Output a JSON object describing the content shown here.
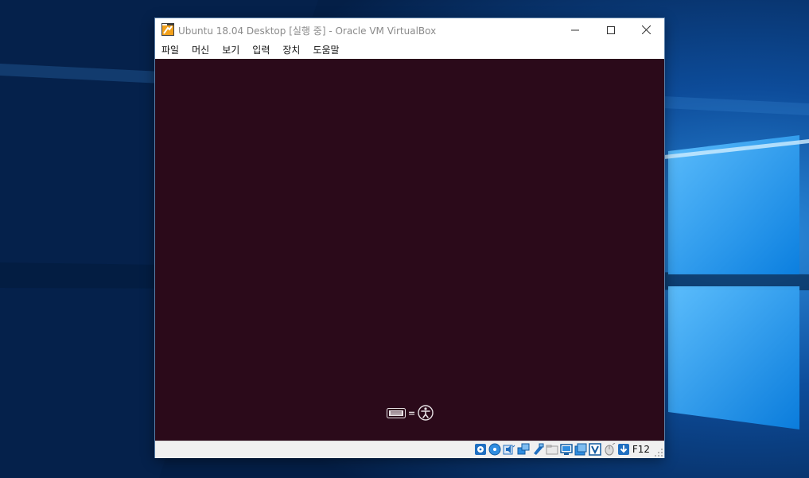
{
  "window": {
    "title": "Ubuntu 18.04 Desktop [실행 중] - Oracle VM VirtualBox"
  },
  "menu": {
    "items": [
      "파일",
      "머신",
      "보기",
      "입력",
      "장치",
      "도움말"
    ]
  },
  "accessibility": {
    "separator": "="
  },
  "statusbar": {
    "host_key": "F12",
    "icons": [
      "hard-disk-icon",
      "optical-drive-icon",
      "audio-icon",
      "network-icon",
      "usb-icon",
      "shared-folders-icon",
      "display-icon",
      "video-capture-icon",
      "virtualization-icon",
      "mouse-integration-icon",
      "keyboard-capture-icon"
    ]
  },
  "colors": {
    "vm_screen": "#2b0a1a",
    "desktop": "#062a5a",
    "accent": "#0078d7"
  }
}
